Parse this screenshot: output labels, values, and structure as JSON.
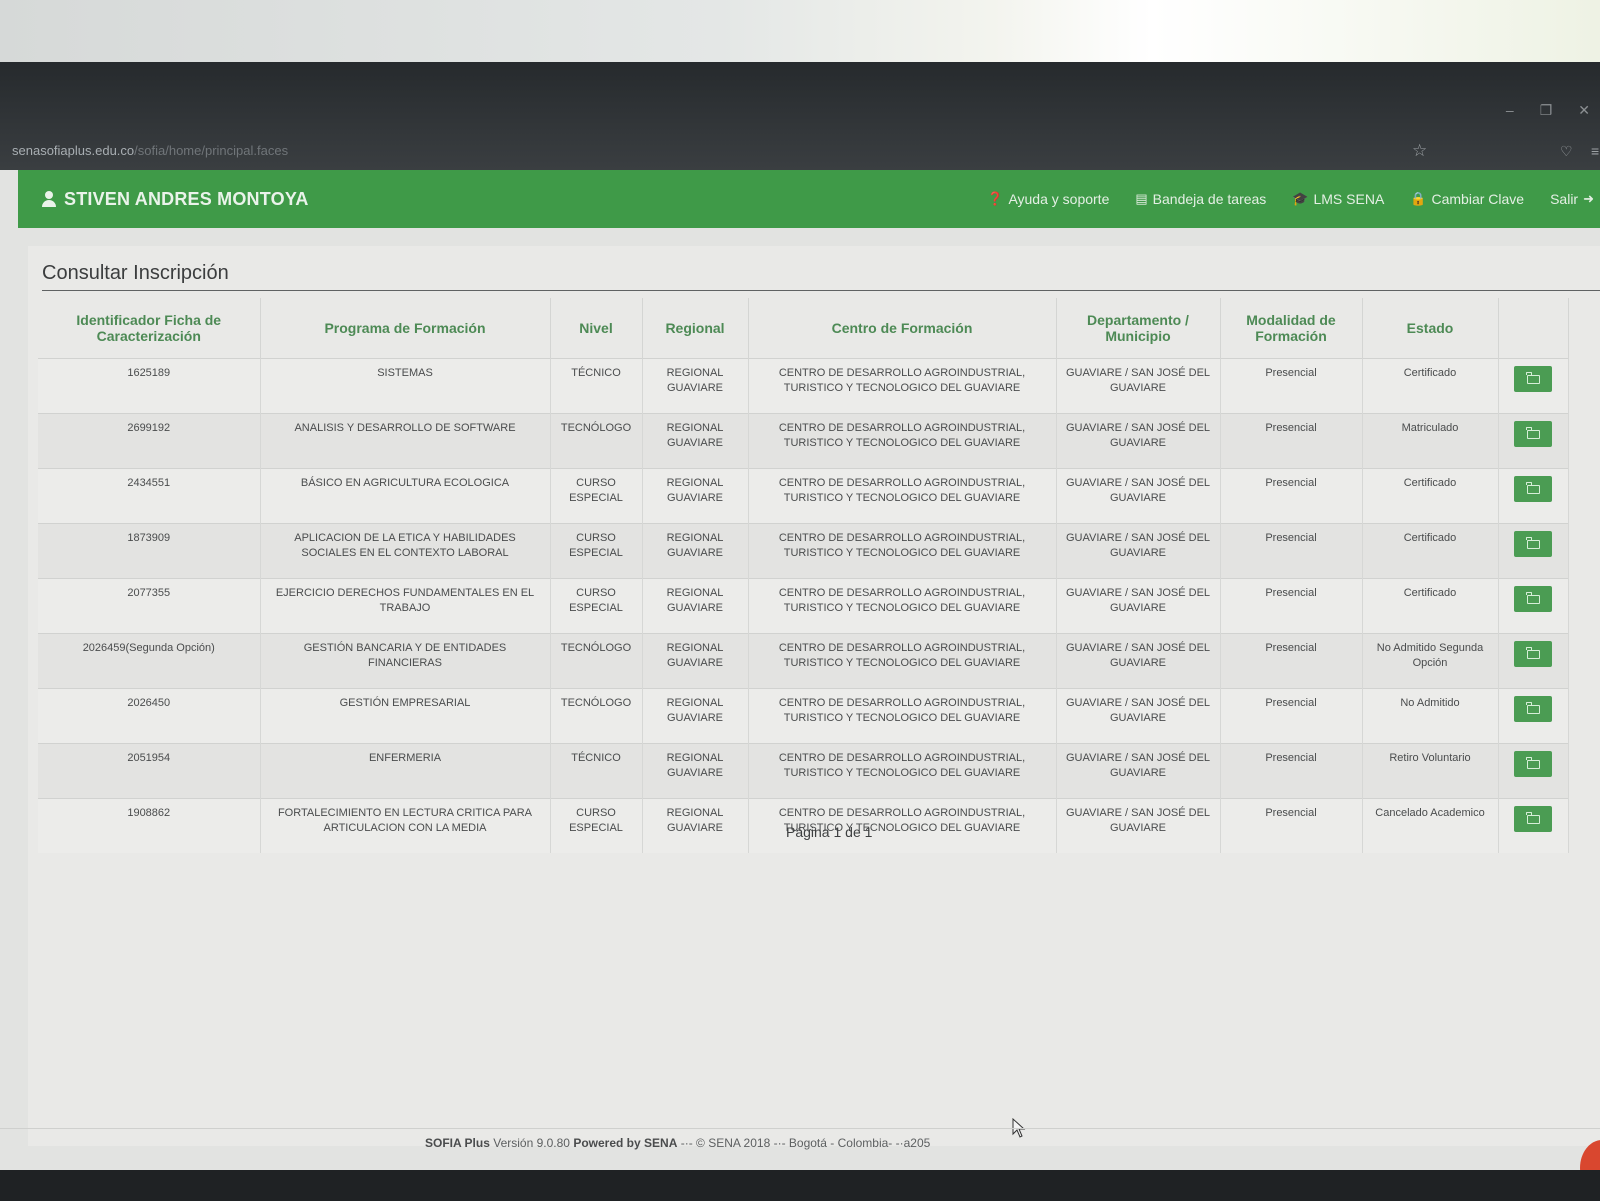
{
  "browser": {
    "url_host": "senasofiaplus.edu.co",
    "url_path": "/sofia/home/principal.faces",
    "star_icon": "star-icon",
    "pocket_icon": "pocket-icon"
  },
  "header": {
    "user_name": "STIVEN ANDRES MONTOYA",
    "nav": [
      {
        "label": "Ayuda y soporte",
        "icon": "question-circle-icon"
      },
      {
        "label": "Bandeja de tareas",
        "icon": "inbox-icon"
      },
      {
        "label": "LMS SENA",
        "icon": "graduation-cap-icon"
      },
      {
        "label": "Cambiar Clave",
        "icon": "lock-icon"
      },
      {
        "label": "Salir",
        "icon": "sign-out-icon"
      }
    ]
  },
  "page": {
    "title": "Consultar Inscripción",
    "columns": [
      "Identificador Ficha de Caracterización",
      "Programa de Formación",
      "Nivel",
      "Regional",
      "Centro de Formación",
      "Departamento / Municipio",
      "Modalidad de Formación",
      "Estado"
    ],
    "rows": [
      {
        "ficha": "1625189",
        "programa": "SISTEMAS",
        "nivel": "TÉCNICO",
        "regional": "REGIONAL GUAVIARE",
        "centro": "CENTRO DE DESARROLLO AGROINDUSTRIAL, TURISTICO Y TECNOLOGICO DEL GUAVIARE",
        "depto": "GUAVIARE / SAN JOSÉ DEL GUAVIARE",
        "modalidad": "Presencial",
        "estado": "Certificado"
      },
      {
        "ficha": "2699192",
        "programa": "ANALISIS Y DESARROLLO DE SOFTWARE",
        "nivel": "TECNÓLOGO",
        "regional": "REGIONAL GUAVIARE",
        "centro": "CENTRO DE DESARROLLO AGROINDUSTRIAL, TURISTICO Y TECNOLOGICO DEL GUAVIARE",
        "depto": "GUAVIARE / SAN JOSÉ DEL GUAVIARE",
        "modalidad": "Presencial",
        "estado": "Matriculado"
      },
      {
        "ficha": "2434551",
        "programa": "BÁSICO EN AGRICULTURA ECOLOGICA",
        "nivel": "CURSO ESPECIAL",
        "regional": "REGIONAL GUAVIARE",
        "centro": "CENTRO DE DESARROLLO AGROINDUSTRIAL, TURISTICO Y TECNOLOGICO DEL GUAVIARE",
        "depto": "GUAVIARE / SAN JOSÉ DEL GUAVIARE",
        "modalidad": "Presencial",
        "estado": "Certificado"
      },
      {
        "ficha": "1873909",
        "programa": "APLICACION DE LA ETICA Y HABILIDADES SOCIALES EN EL CONTEXTO LABORAL",
        "nivel": "CURSO ESPECIAL",
        "regional": "REGIONAL GUAVIARE",
        "centro": "CENTRO DE DESARROLLO AGROINDUSTRIAL, TURISTICO Y TECNOLOGICO DEL GUAVIARE",
        "depto": "GUAVIARE / SAN JOSÉ DEL GUAVIARE",
        "modalidad": "Presencial",
        "estado": "Certificado"
      },
      {
        "ficha": "2077355",
        "programa": "EJERCICIO DERECHOS FUNDAMENTALES EN EL TRABAJO",
        "nivel": "CURSO ESPECIAL",
        "regional": "REGIONAL GUAVIARE",
        "centro": "CENTRO DE DESARROLLO AGROINDUSTRIAL, TURISTICO Y TECNOLOGICO DEL GUAVIARE",
        "depto": "GUAVIARE / SAN JOSÉ DEL GUAVIARE",
        "modalidad": "Presencial",
        "estado": "Certificado"
      },
      {
        "ficha": "2026459(Segunda Opción)",
        "programa": "GESTIÓN BANCARIA Y DE ENTIDADES FINANCIERAS",
        "nivel": "TECNÓLOGO",
        "regional": "REGIONAL GUAVIARE",
        "centro": "CENTRO DE DESARROLLO AGROINDUSTRIAL, TURISTICO Y TECNOLOGICO DEL GUAVIARE",
        "depto": "GUAVIARE / SAN JOSÉ DEL GUAVIARE",
        "modalidad": "Presencial",
        "estado": "No Admitido Segunda Opción"
      },
      {
        "ficha": "2026450",
        "programa": "GESTIÓN EMPRESARIAL",
        "nivel": "TECNÓLOGO",
        "regional": "REGIONAL GUAVIARE",
        "centro": "CENTRO DE DESARROLLO AGROINDUSTRIAL, TURISTICO Y TECNOLOGICO DEL GUAVIARE",
        "depto": "GUAVIARE / SAN JOSÉ DEL GUAVIARE",
        "modalidad": "Presencial",
        "estado": "No Admitido"
      },
      {
        "ficha": "2051954",
        "programa": "ENFERMERIA",
        "nivel": "TÉCNICO",
        "regional": "REGIONAL GUAVIARE",
        "centro": "CENTRO DE DESARROLLO AGROINDUSTRIAL, TURISTICO Y TECNOLOGICO DEL GUAVIARE",
        "depto": "GUAVIARE / SAN JOSÉ DEL GUAVIARE",
        "modalidad": "Presencial",
        "estado": "Retiro Voluntario"
      },
      {
        "ficha": "1908862",
        "programa": "FORTALECIMIENTO EN LECTURA CRITICA PARA ARTICULACION CON LA MEDIA",
        "nivel": "CURSO ESPECIAL",
        "regional": "REGIONAL GUAVIARE",
        "centro": "CENTRO DE DESARROLLO AGROINDUSTRIAL, TURISTICO Y TECNOLOGICO DEL GUAVIARE",
        "depto": "GUAVIARE / SAN JOSÉ DEL GUAVIARE",
        "modalidad": "Presencial",
        "estado": "Cancelado Academico"
      }
    ],
    "row_action_icon": "folder-icon",
    "pagination": "Página 1 de 1"
  },
  "footer": {
    "brand": "SOFIA Plus",
    "version": "Versión 9.0.80",
    "powered": "Powered by SENA",
    "rest": "-·- © SENA 2018 -·- Bogotá - Colombia- -·a205"
  },
  "colors": {
    "brand_green": "#3f9a48",
    "header_text_green": "#4d8a55"
  }
}
